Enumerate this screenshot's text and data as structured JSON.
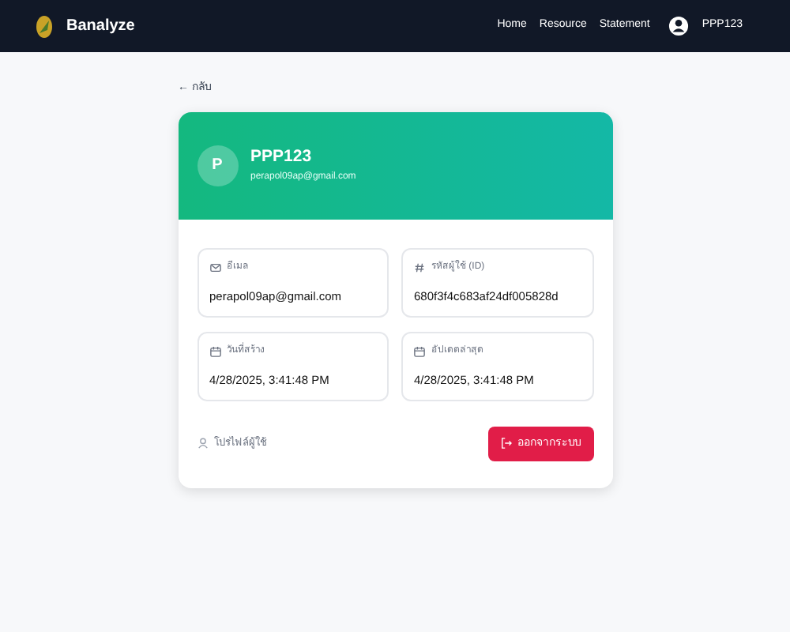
{
  "navbar": {
    "brand": "Banalyze",
    "links": [
      {
        "label": "Home"
      },
      {
        "label": "Resource"
      },
      {
        "label": "Statement"
      }
    ],
    "user": "PPP123"
  },
  "back_link": "← กลับ",
  "profile": {
    "initial": "P",
    "name": "PPP123",
    "email": "perapol09ap@gmail.com"
  },
  "fields": [
    {
      "kind": "mail",
      "label": "อีเมล",
      "value": "perapol09ap@gmail.com"
    },
    {
      "kind": "id",
      "label": "รหัสผู้ใช้ (ID)",
      "value": "680f3f4c683af24df005828d"
    },
    {
      "kind": "calendar",
      "label": "วันที่สร้าง",
      "value": "4/28/2025, 3:41:48 PM"
    },
    {
      "kind": "calendar",
      "label": "อัปเดตล่าสุด",
      "value": "4/28/2025, 3:41:48 PM"
    }
  ],
  "footer": {
    "caption": "โปรไฟล์ผู้ใช้",
    "logout": "ออกจากระบบ"
  }
}
